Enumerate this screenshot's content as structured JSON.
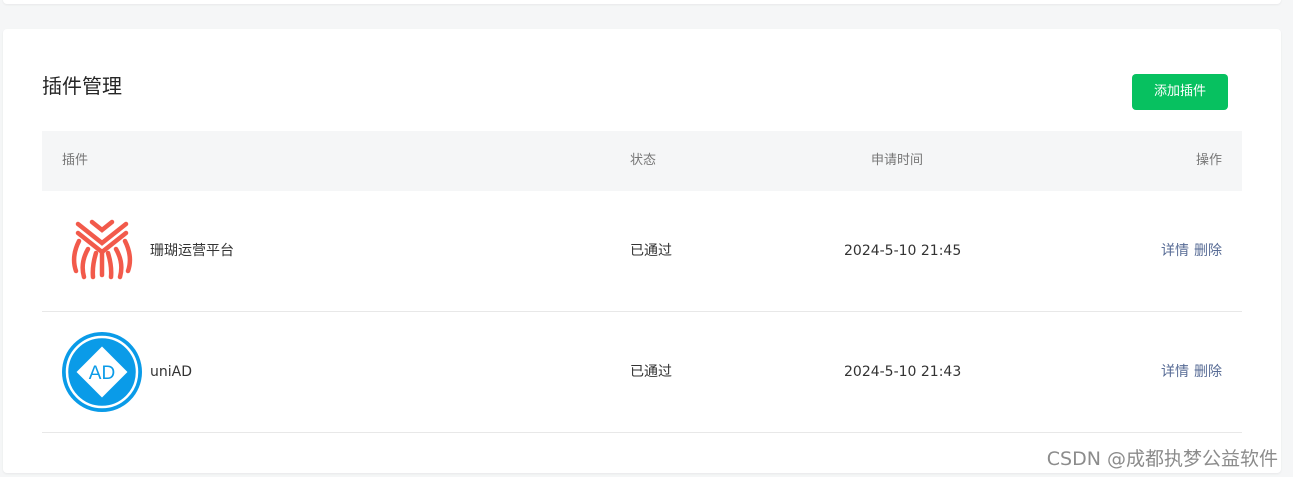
{
  "page": {
    "title": "插件管理",
    "add_button_label": "添加插件"
  },
  "table": {
    "headers": {
      "plugin": "插件",
      "status": "状态",
      "apply_time": "申请时间",
      "actions": "操作"
    },
    "rows": [
      {
        "name": "珊瑚运营平台",
        "logo_icon": "coral-logo-icon",
        "status": "已通过",
        "apply_time": "2024-5-10 21:45",
        "detail_label": "详情",
        "delete_label": "删除"
      },
      {
        "name": "uniAD",
        "logo_icon": "uniad-logo-icon",
        "logo_text": "AD",
        "status": "已通过",
        "apply_time": "2024-5-10 21:43",
        "detail_label": "详情",
        "delete_label": "删除"
      }
    ]
  },
  "watermark": "CSDN @成都执梦公益软件",
  "colors": {
    "primary_button": "#07c160",
    "link": "#576b95",
    "coral_logo": "#f25a4b",
    "uniad_logo": "#0a9be8",
    "header_bg": "#f5f6f7"
  }
}
